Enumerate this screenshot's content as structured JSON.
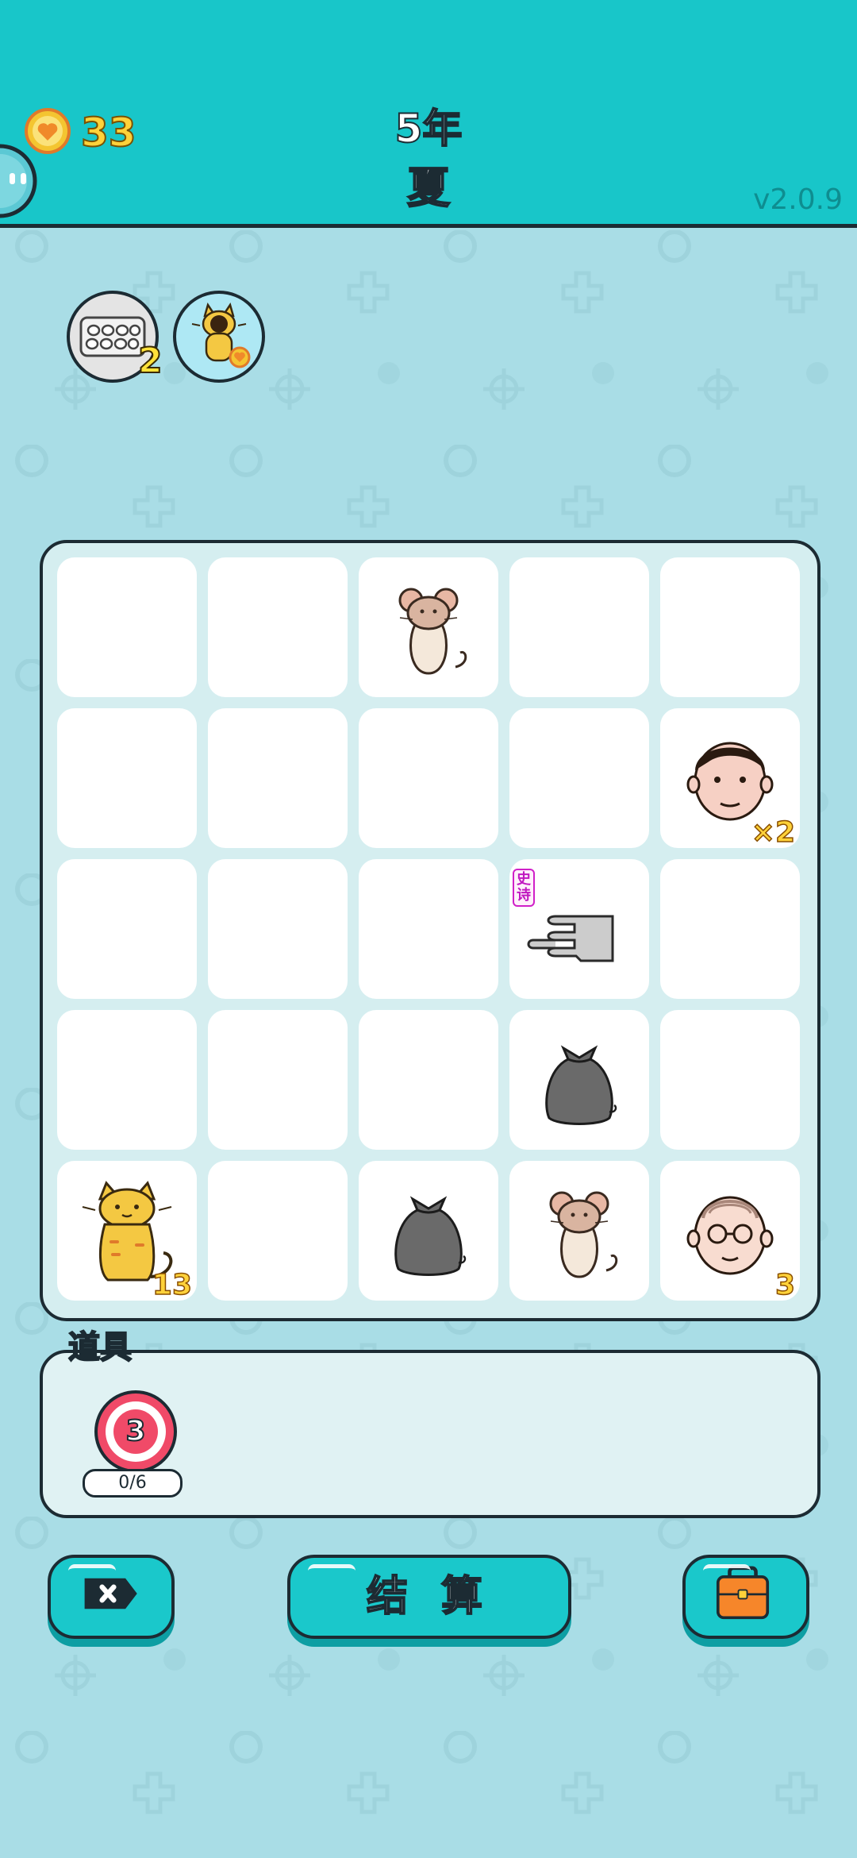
{
  "header": {
    "coins": "33",
    "year": "5年",
    "season": "夏",
    "version": "v2.0.9"
  },
  "status": [
    {
      "name": "egg-carton",
      "count": "2"
    },
    {
      "name": "cat-buff",
      "count": ""
    }
  ],
  "board": {
    "cols": 5,
    "rows": 5,
    "cells": [
      {
        "icon": ""
      },
      {
        "icon": ""
      },
      {
        "icon": "mouse"
      },
      {
        "icon": ""
      },
      {
        "icon": ""
      },
      {
        "icon": ""
      },
      {
        "icon": ""
      },
      {
        "icon": ""
      },
      {
        "icon": ""
      },
      {
        "icon": "man-face",
        "badge": "×2"
      },
      {
        "icon": ""
      },
      {
        "icon": ""
      },
      {
        "icon": ""
      },
      {
        "icon": "pointing-hand",
        "tag": "史诗"
      },
      {
        "icon": ""
      },
      {
        "icon": ""
      },
      {
        "icon": ""
      },
      {
        "icon": ""
      },
      {
        "icon": "trash-bag"
      },
      {
        "icon": ""
      },
      {
        "icon": "cat",
        "badge": "13"
      },
      {
        "icon": ""
      },
      {
        "icon": "trash-bag"
      },
      {
        "icon": "mouse"
      },
      {
        "icon": "old-man-face",
        "badge": "3"
      }
    ]
  },
  "tools": {
    "label": "道具",
    "item": {
      "name": "target-icon",
      "number": "3",
      "progress": "0/6"
    }
  },
  "buttons": {
    "settle": "结 算"
  },
  "colors": {
    "header": "#18c6c9",
    "background": "#a9dde6",
    "coin": "#ffd23a",
    "button": "#1ac8cb"
  }
}
